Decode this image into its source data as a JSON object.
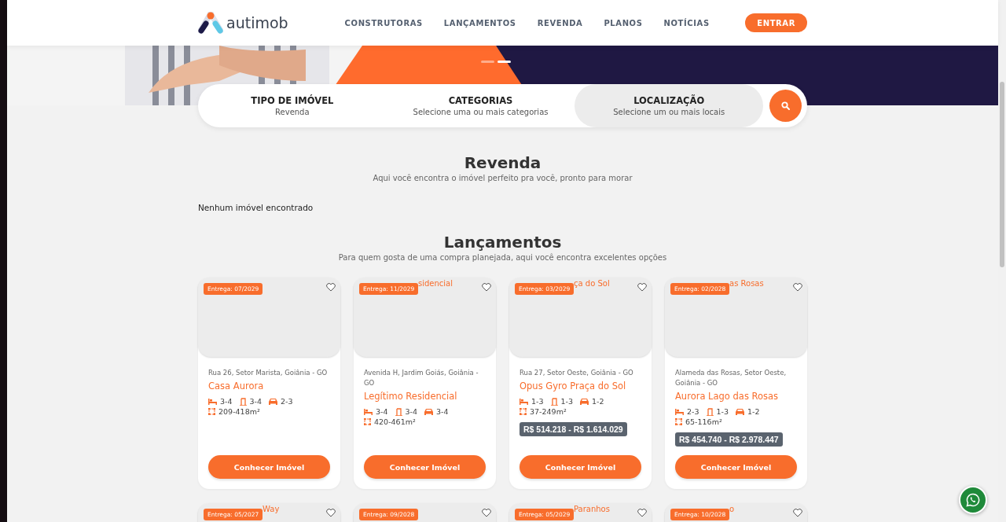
{
  "header": {
    "logo": "autimob",
    "nav": [
      {
        "label": "CONSTRUTORAS"
      },
      {
        "label": "LANÇAMENTOS"
      },
      {
        "label": "REVENDA"
      },
      {
        "label": "PLANOS"
      },
      {
        "label": "NOTÍCIAS"
      }
    ],
    "login": "ENTRAR"
  },
  "hero": {
    "slides": [
      {
        "selected": false
      },
      {
        "selected": true
      }
    ]
  },
  "search": {
    "fields": [
      {
        "label": "TIPO DE IMÓVEL",
        "value": "Revenda",
        "selected": false
      },
      {
        "label": "CATEGORIAS",
        "value": "Selecione uma ou mais categorias",
        "selected": false
      },
      {
        "label": "LOCALIZAÇÃO",
        "value": "Selecione um ou mais locais",
        "selected": true
      }
    ]
  },
  "resale": {
    "title": "Revenda",
    "subtitle": "Aqui você encontra o imóvel perfeito pra você, pronto para morar",
    "empty": "Nenhum imóvel encontrado"
  },
  "launches": {
    "title": "Lançamentos",
    "subtitle": "Para quem gosta de uma compra planejada, aqui você encontra excelentes opções",
    "cards": [
      {
        "delivery": "Entrega: 07/2029",
        "address": "Rua 26, Setor Marista, Goiânia - GO",
        "name": "Casa Aurora",
        "beds": "3-4",
        "baths": "3-4",
        "parking": "2-3",
        "area": "209-418m²",
        "button": "Conhecer Imóvel"
      },
      {
        "delivery": "Entrega: 11/2029",
        "alt": "sidencial",
        "address": "Avenida H, Jardim Goiás, Goiânia - GO",
        "name": "Legítimo Residencial",
        "beds": "3-4",
        "baths": "3-4",
        "parking": "3-4",
        "area": "420-461m²",
        "button": "Conhecer Imóvel"
      },
      {
        "delivery": "Entrega: 03/2029",
        "alt": "ça do Sol",
        "address": "Rua 27, Setor Oeste, Goiânia - GO",
        "name": "Opus Gyro Praça do Sol",
        "beds": "1-3",
        "baths": "1-3",
        "parking": "1-2",
        "area": "37-249m²",
        "price": "R$ 514.218 - R$ 1.614.029",
        "button": "Conhecer Imóvel"
      },
      {
        "delivery": "Entrega: 02/2028",
        "alt": "as Rosas",
        "address": "Alameda das Rosas, Setor Oeste, Goiânia - GO",
        "name": "Aurora Lago das Rosas",
        "beds": "2-3",
        "baths": "1-3",
        "parking": "1-2",
        "area": "65-116m²",
        "price": "R$ 454.740 - R$ 2.978.447",
        "button": "Conhecer Imóvel"
      },
      {
        "delivery": "Entrega: 05/2027",
        "alt": "Way"
      },
      {
        "delivery": "Entrega: 09/2028"
      },
      {
        "delivery": "Entrega: 05/2029",
        "alt": "Paranhos"
      },
      {
        "delivery": "Entrega: 10/2028",
        "alt": "o"
      }
    ]
  }
}
